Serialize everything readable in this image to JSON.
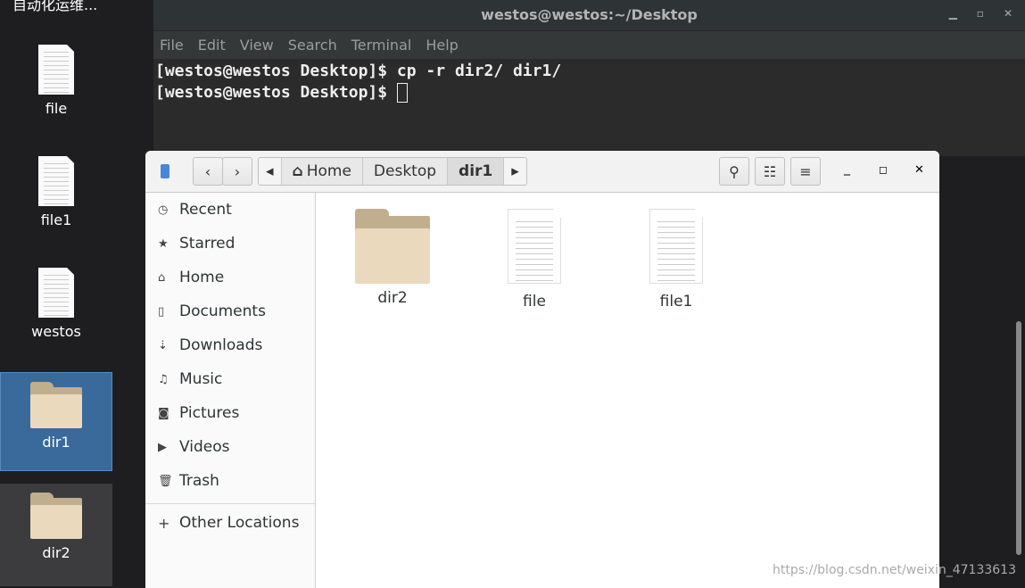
{
  "desktop": {
    "top_label": "自动化运维...",
    "icons": [
      {
        "label": "file",
        "type": "doc"
      },
      {
        "label": "file1",
        "type": "doc"
      },
      {
        "label": "westos",
        "type": "doc"
      },
      {
        "label": "dir1",
        "type": "folder",
        "selected": true
      },
      {
        "label": "dir2",
        "type": "folder"
      }
    ]
  },
  "terminal": {
    "title": "westos@westos:~/Desktop",
    "menu": [
      "File",
      "Edit",
      "View",
      "Search",
      "Terminal",
      "Help"
    ],
    "lines": [
      "[westos@westos Desktop]$ cp -r dir2/ dir1/",
      "[westos@westos Desktop]$ "
    ]
  },
  "files": {
    "breadcrumb": [
      "Home",
      "Desktop",
      "dir1"
    ],
    "sidebar": [
      {
        "label": "Recent",
        "icon": "clock-icon"
      },
      {
        "label": "Starred",
        "icon": "star-icon"
      },
      {
        "label": "Home",
        "icon": "home-icon"
      },
      {
        "label": "Documents",
        "icon": "document-icon"
      },
      {
        "label": "Downloads",
        "icon": "download-icon"
      },
      {
        "label": "Music",
        "icon": "music-icon"
      },
      {
        "label": "Pictures",
        "icon": "camera-icon"
      },
      {
        "label": "Videos",
        "icon": "video-icon"
      },
      {
        "label": "Trash",
        "icon": "trash-icon"
      }
    ],
    "other_locations": "Other Locations",
    "items": [
      {
        "label": "dir2",
        "type": "folder"
      },
      {
        "label": "file",
        "type": "doc"
      },
      {
        "label": "file1",
        "type": "doc"
      }
    ]
  },
  "watermark": "https://blog.csdn.net/weixin_47133613",
  "colors": {
    "selection": "#3a6a9b",
    "folder": "#ead9bd"
  }
}
